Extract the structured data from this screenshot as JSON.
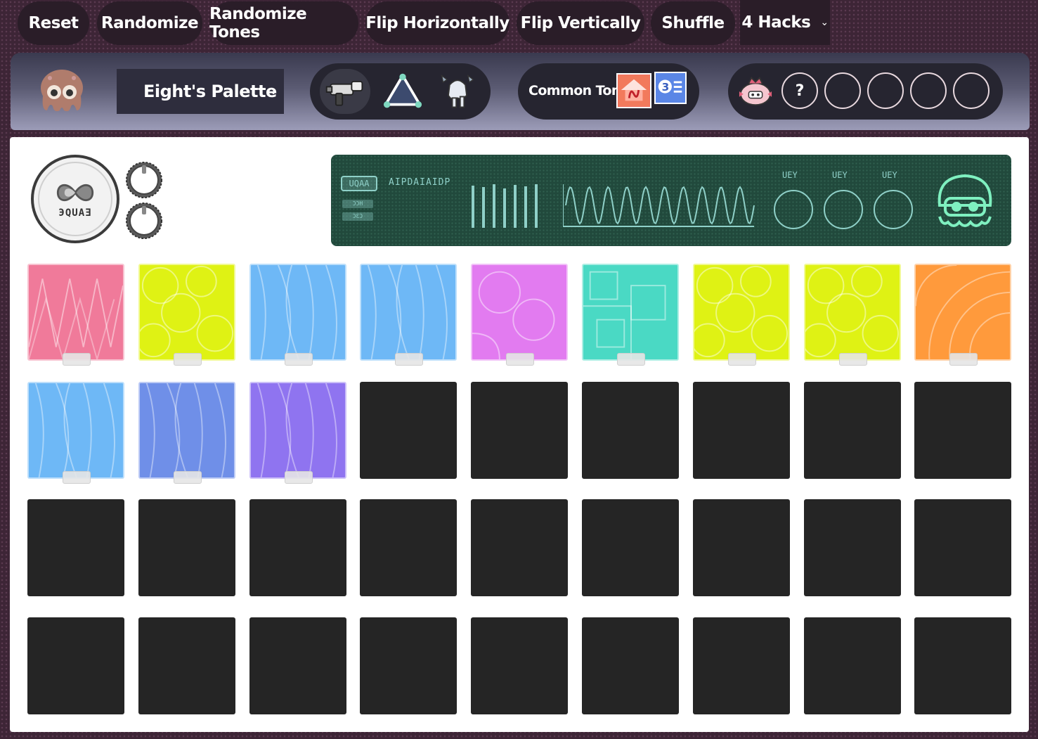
{
  "toolbar": {
    "buttons": [
      {
        "label": "Reset"
      },
      {
        "label": "Randomize"
      },
      {
        "label": "Randomize Tones"
      },
      {
        "label": "Flip Horizontally"
      },
      {
        "label": "Flip Vertically"
      },
      {
        "label": "Shuffle"
      }
    ],
    "hacks_label": "4 Hacks",
    "chevron": "⌄"
  },
  "header": {
    "avatar_icon": "octoling-avatar-icon",
    "palette_value": "Eight's Palette",
    "chevron": "⌄",
    "tools": [
      "splattershot-icon",
      "triangle-tool-icon",
      "character-pose-icon"
    ],
    "common_tones_label": "Common Tones",
    "tone_icons": [
      "tone-sticker-red-icon",
      "tone-sticker-blue-icon"
    ],
    "hack_slots": {
      "mascot_icon": "pink-mascot-icon",
      "slots": [
        "?",
        "",
        "",
        "",
        ""
      ]
    }
  },
  "sampler": {
    "logo_text": "ЭQUAƎ",
    "screen": {
      "tag": "UQAA",
      "text": "AIPDAIAIDP",
      "mini1": "ƆƆH",
      "mini2": "ƆƐƆ",
      "ring_labels": [
        "UEY",
        "UEY",
        "UEY"
      ]
    }
  },
  "pads": {
    "colors": [
      "#f07a9a",
      "#dff214",
      "#6eb8f6",
      "#6eb8f6",
      "#e27bf0",
      "#4ad9c4",
      "#dff214",
      "#dff214",
      "#ff9a3c",
      "#6eb8f6",
      "#6f8fe8",
      "#8f74f0"
    ],
    "patterns": [
      "zigzag",
      "circles",
      "waves",
      "waves",
      "loops",
      "squares",
      "circles",
      "circles",
      "arcs",
      "waves",
      "waves",
      "waves"
    ],
    "empty_count": 24
  },
  "colors": {
    "bg": "#3d2536",
    "button": "#2a1d28",
    "screen": "#21493c",
    "screen_fg": "#8fd0c8",
    "empty_pad": "#252525"
  }
}
